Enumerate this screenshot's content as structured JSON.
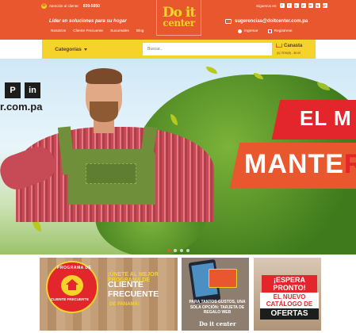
{
  "header": {
    "phone_label": "Atención al cliente:",
    "phone_number": "830-5050",
    "tagline": "Líder en soluciones para su hogar",
    "nav": [
      "Nosotros",
      "Cliente Frecuente",
      "Sucursales",
      "Blog"
    ],
    "logo_line1": "Do it",
    "logo_line2": "center",
    "follow_label": "Síguenos en:",
    "social_icons": [
      "f",
      "t",
      "y",
      "p",
      "in",
      "ig",
      "g+"
    ],
    "email": "sugerencias@doitcenter.com.pa",
    "login": "Ingresar",
    "register": "Registrese"
  },
  "search": {
    "categories_label": "Categorías",
    "placeholder": "Buscar...",
    "cart_title": "Canasta",
    "cart_sub": "(0) ITEM(S) - $0.00"
  },
  "hero": {
    "social_icons": [
      "P",
      "in"
    ],
    "url_text": "r.com.pa",
    "banner_top": "EL M",
    "banner_bottom_a": "MANTE",
    "banner_bottom_b": "R",
    "slides": 4,
    "active_slide": 0
  },
  "cards": [
    {
      "seal_top": "PROGRAMA DE",
      "seal_bottom": "CLIENTE FRECUENTE",
      "line1": "¡ÚNETE AL MEJOR PROGRAMA DE",
      "line2": "CLIENTE FRECUENTE",
      "line3": "DE PANAMÁ!"
    },
    {
      "text": "PARA TANTOS GUSTOS, UNA SOLA OPCIÓN: TARJETA DE REGALO WEB",
      "logo": "Do it center"
    },
    {
      "line1": "¡ESPERA PRONTO!",
      "line2": "EL NUEVO CATÁLOGO DE",
      "line3": "OFERTAS"
    }
  ],
  "colors": {
    "brand_orange": "#e8572e",
    "brand_yellow": "#f6d32a",
    "brand_red": "#e3262c"
  }
}
